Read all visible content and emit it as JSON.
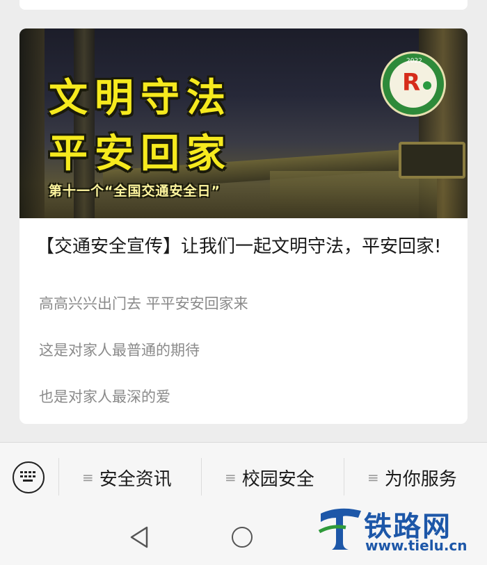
{
  "banner": {
    "headline_line1": "文明守法",
    "headline_line2": "平安回家",
    "subtitle": "第十一个“全国交通安全日”",
    "emblem_year": "2022"
  },
  "article": {
    "title": "【交通安全宣传】让我们一起文明守法，平安回家!",
    "paragraphs": [
      "高高兴兴出门去 平平安安回家来",
      "这是对家人最普通的期待",
      "也是对家人最深的爱"
    ]
  },
  "menu": {
    "keyboard_icon": "keyboard-icon",
    "items": [
      {
        "label": "安全资讯",
        "icon": "menu-lines-icon"
      },
      {
        "label": "校园安全",
        "icon": "menu-lines-icon"
      },
      {
        "label": "为你服务",
        "icon": "menu-lines-icon"
      }
    ]
  },
  "watermark": {
    "name": "铁路网",
    "url": "www.tielu.cn"
  },
  "colors": {
    "headline": "#f6ea1e",
    "watermark": "#1d57a8",
    "background": "#ededed"
  }
}
